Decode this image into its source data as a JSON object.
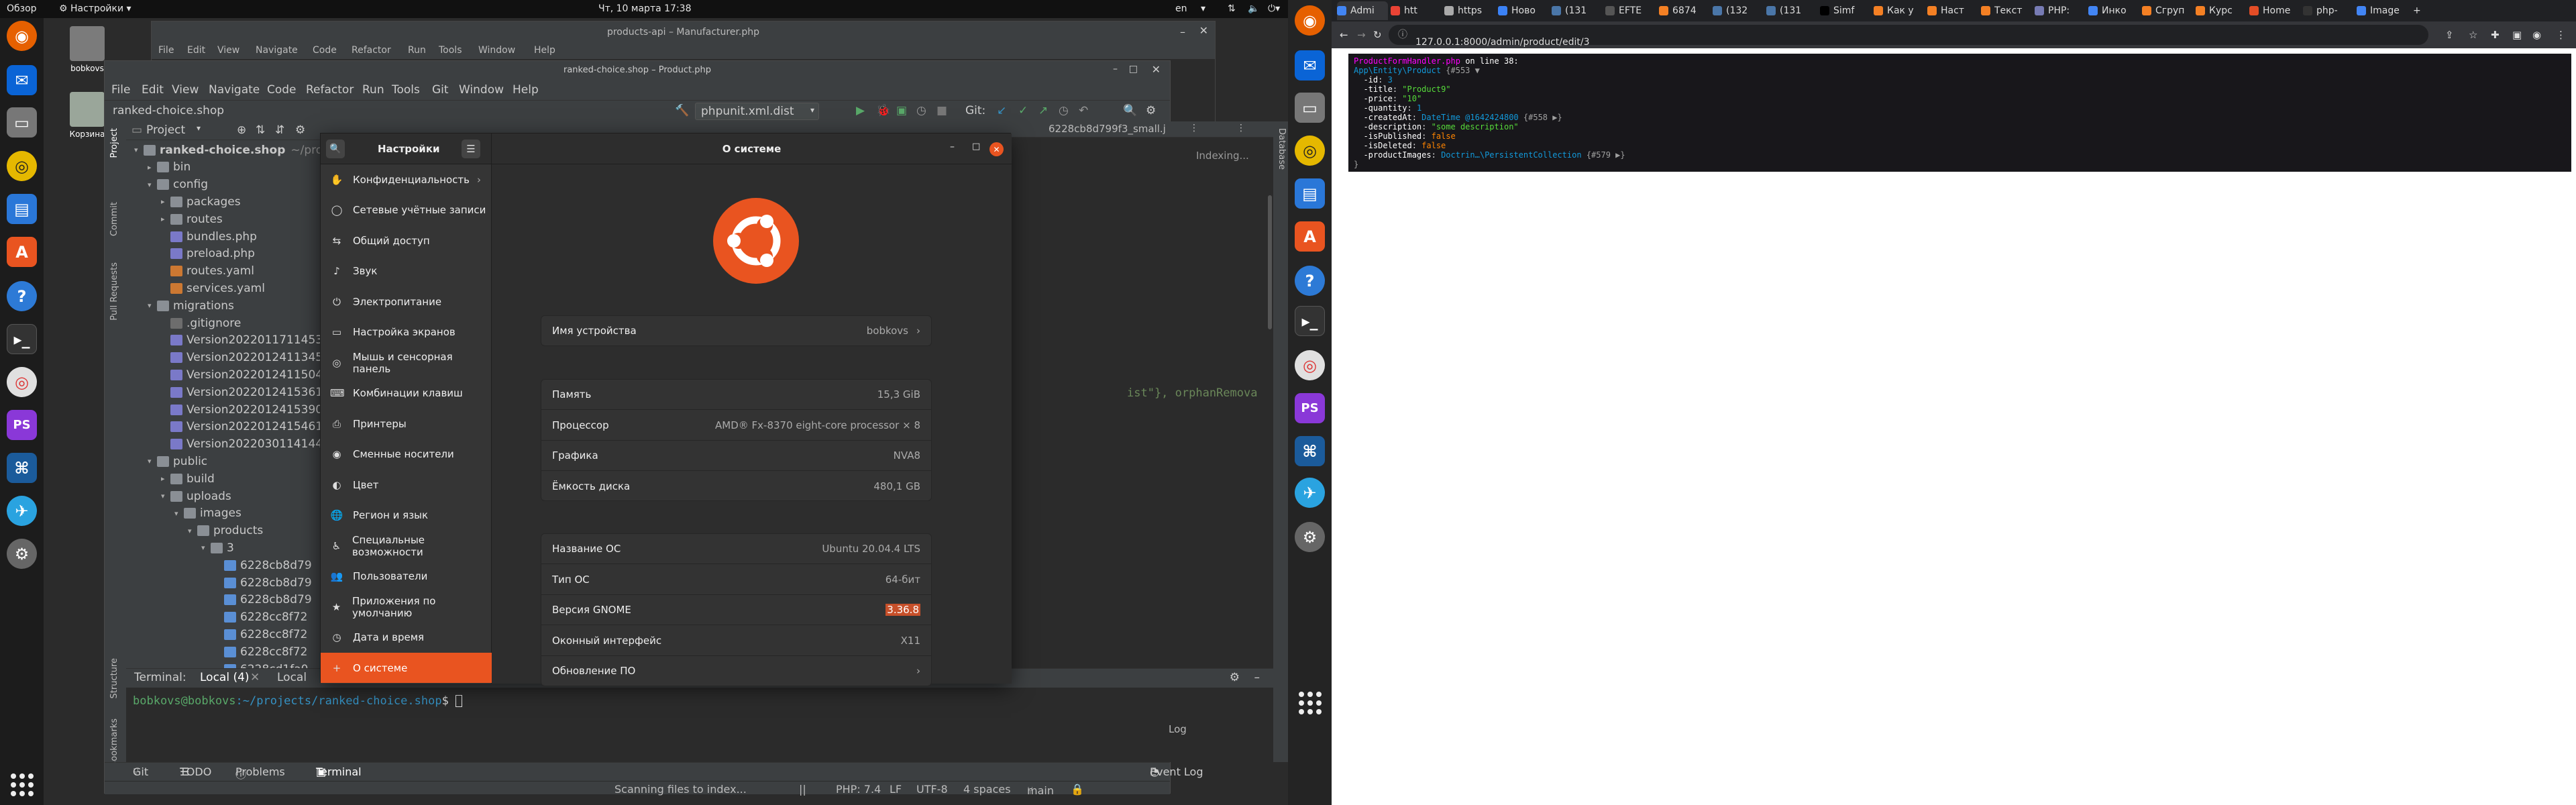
{
  "topbar": {
    "overview": "Обзор",
    "app_menu": "Настройки",
    "clock": "Чт, 10 марта  17:38",
    "lang": "en"
  },
  "desktop_icons": [
    {
      "label": "bobkovs",
      "name": "home-folder"
    },
    {
      "label": "Корзина",
      "name": "trash"
    }
  ],
  "ide_back": {
    "title": "products-api – Manufacturer.php",
    "menu": [
      "File",
      "Edit",
      "View",
      "Navigate",
      "Code",
      "Refactor",
      "Run",
      "Tools",
      "Window",
      "Help"
    ]
  },
  "ide": {
    "title": "ranked-choice.shop – Product.php",
    "menu": [
      "File",
      "Edit",
      "View",
      "Navigate",
      "Code",
      "Refactor",
      "Run",
      "Tools",
      "Git",
      "Window",
      "Help"
    ],
    "breadcrumb": "ranked-choice.shop",
    "run_config": "phpunit.xml.dist",
    "git_label": "Git:",
    "project_header": "Project",
    "indexing": "Indexing...",
    "editor_file_tab": "6228cb8d799f3_small.j",
    "code_fragment": "ist\"}, orphanRemova",
    "side_tabs": [
      "Project",
      "Commit",
      "Pull Requests",
      "Structure",
      "Bookmarks"
    ],
    "right_tabs": [
      "Database"
    ],
    "tree": [
      {
        "label": "ranked-choice.shop",
        "suffix": "~/proje",
        "level": 0,
        "kind": "folder",
        "open": true,
        "bold": true
      },
      {
        "label": "bin",
        "level": 1,
        "kind": "folder",
        "open": false
      },
      {
        "label": "config",
        "level": 1,
        "kind": "folder",
        "open": true
      },
      {
        "label": "packages",
        "level": 2,
        "kind": "folder",
        "open": false
      },
      {
        "label": "routes",
        "level": 2,
        "kind": "folder",
        "open": false
      },
      {
        "label": "bundles.php",
        "level": 2,
        "kind": "php"
      },
      {
        "label": "preload.php",
        "level": 2,
        "kind": "php"
      },
      {
        "label": "routes.yaml",
        "level": 2,
        "kind": "yml"
      },
      {
        "label": "services.yaml",
        "level": 2,
        "kind": "yml"
      },
      {
        "label": "migrations",
        "level": 1,
        "kind": "folder",
        "open": true
      },
      {
        "label": ".gitignore",
        "level": 2,
        "kind": "git"
      },
      {
        "label": "Version2022011711453",
        "level": 2,
        "kind": "php"
      },
      {
        "label": "Version2022012411345",
        "level": 2,
        "kind": "php"
      },
      {
        "label": "Version2022012411504",
        "level": 2,
        "kind": "php"
      },
      {
        "label": "Version2022012415361",
        "level": 2,
        "kind": "php"
      },
      {
        "label": "Version2022012415390",
        "level": 2,
        "kind": "php"
      },
      {
        "label": "Version2022012415461",
        "level": 2,
        "kind": "php"
      },
      {
        "label": "Version2022030114144",
        "level": 2,
        "kind": "php"
      },
      {
        "label": "public",
        "level": 1,
        "kind": "folder",
        "open": true
      },
      {
        "label": "build",
        "level": 2,
        "kind": "folder",
        "open": false
      },
      {
        "label": "uploads",
        "level": 2,
        "kind": "folder",
        "open": true
      },
      {
        "label": "images",
        "level": 3,
        "kind": "folder",
        "open": true
      },
      {
        "label": "products",
        "level": 4,
        "kind": "folder",
        "open": true
      },
      {
        "label": "3",
        "level": 5,
        "kind": "folder",
        "open": true
      },
      {
        "label": "6228cb8d79",
        "level": 6,
        "kind": "png"
      },
      {
        "label": "6228cb8d79",
        "level": 6,
        "kind": "png"
      },
      {
        "label": "6228cb8d79",
        "level": 6,
        "kind": "png"
      },
      {
        "label": "6228cc8f72",
        "level": 6,
        "kind": "png"
      },
      {
        "label": "6228cc8f72",
        "level": 6,
        "kind": "png"
      },
      {
        "label": "6228cc8f72",
        "level": 6,
        "kind": "png"
      },
      {
        "label": "6228cd1fa0",
        "level": 6,
        "kind": "png"
      }
    ],
    "terminal": {
      "label": "Terminal:",
      "tabs": [
        "Local (4)",
        "Local"
      ],
      "prompt_user": "bobkovs@bobkovs",
      "prompt_path": ":~/projects/ranked-choice.shop",
      "prompt_sign": "$"
    },
    "bottom_tabs": [
      "Git",
      "TODO",
      "Problems",
      "Terminal"
    ],
    "event_log": "Event Log",
    "status": {
      "scanning": "Scanning files to index...",
      "php": "PHP: 7.4",
      "lf": "LF",
      "encoding": "UTF-8",
      "indent": "4 spaces",
      "branch": "main"
    },
    "side_log": "Log"
  },
  "settings": {
    "sidebar_title": "Настройки",
    "page_title": "О системе",
    "items": [
      {
        "label": "Конфиденциальность",
        "icon": "hand-icon",
        "glyph": "✋",
        "chevron": true
      },
      {
        "label": "Сетевые учётные записи",
        "icon": "accounts-icon",
        "glyph": "◯"
      },
      {
        "label": "Общий доступ",
        "icon": "share-icon",
        "glyph": "⇆"
      },
      {
        "label": "Звук",
        "icon": "music-icon",
        "glyph": "♪"
      },
      {
        "label": "Электропитание",
        "icon": "power-icon",
        "glyph": "⏻"
      },
      {
        "label": "Настройка экранов",
        "icon": "display-icon",
        "glyph": "▭"
      },
      {
        "label": "Мышь и сенсорная панель",
        "icon": "mouse-icon",
        "glyph": "◎"
      },
      {
        "label": "Комбинации клавиш",
        "icon": "keyboard-icon",
        "glyph": "⌨"
      },
      {
        "label": "Принтеры",
        "icon": "printer-icon",
        "glyph": "⎙"
      },
      {
        "label": "Сменные носители",
        "icon": "disk-icon",
        "glyph": "◉"
      },
      {
        "label": "Цвет",
        "icon": "color-icon",
        "glyph": "◐"
      },
      {
        "label": "Регион и язык",
        "icon": "globe-icon",
        "glyph": "🌐"
      },
      {
        "label": "Специальные возможности",
        "icon": "accessibility-icon",
        "glyph": "♿"
      },
      {
        "label": "Пользователи",
        "icon": "users-icon",
        "glyph": "👥"
      },
      {
        "label": "Приложения по умолчанию",
        "icon": "star-icon",
        "glyph": "★"
      },
      {
        "label": "Дата и время",
        "icon": "clock-icon",
        "glyph": "◷"
      },
      {
        "label": "О системе",
        "icon": "plus-icon",
        "glyph": "+",
        "active": true
      }
    ],
    "device_name": {
      "label": "Имя устройства",
      "value": "bobkovs"
    },
    "hardware": [
      {
        "label": "Память",
        "value": "15,3 GiB"
      },
      {
        "label": "Процессор",
        "value": "AMD® Fx-8370 eight-core processor × 8"
      },
      {
        "label": "Графика",
        "value": "NVA8"
      },
      {
        "label": "Ёмкость диска",
        "value": "480,1 GB"
      }
    ],
    "os": [
      {
        "label": "Название ОС",
        "value": "Ubuntu 20.04.4 LTS"
      },
      {
        "label": "Тип ОС",
        "value": "64-бит"
      },
      {
        "label": "Версия GNOME",
        "value": "3.36.8",
        "highlight": true
      },
      {
        "label": "Оконный интерфейс",
        "value": "X11"
      },
      {
        "label": "Обновление ПО",
        "value": "",
        "chevron": true
      }
    ],
    "colors": {
      "accent": "#e95420",
      "highlight": "#c7502a"
    }
  },
  "browser": {
    "tabs": [
      {
        "label": "Admi",
        "color": "#4285f4"
      },
      {
        "label": "htt",
        "color": "#ea4335"
      },
      {
        "label": "https",
        "color": "#aaaaaa"
      },
      {
        "label": "Ново",
        "color": "#3b82f6"
      },
      {
        "label": "(131",
        "color": "#4a76a8"
      },
      {
        "label": "EFTE",
        "color": "#555555"
      },
      {
        "label": "6874",
        "color": "#f48024"
      },
      {
        "label": "(132",
        "color": "#4a76a8"
      },
      {
        "label": "(131",
        "color": "#4a76a8"
      },
      {
        "label": "Simf",
        "color": "#000000"
      },
      {
        "label": "Как у",
        "color": "#f48024"
      },
      {
        "label": "Наст",
        "color": "#f48024"
      },
      {
        "label": "Текст",
        "color": "#f48024"
      },
      {
        "label": "PHP:",
        "color": "#777bb4"
      },
      {
        "label": "Инко",
        "color": "#4285f4"
      },
      {
        "label": "Сгруп",
        "color": "#f48024"
      },
      {
        "label": "Курс",
        "color": "#f48024"
      },
      {
        "label": "Home",
        "color": "#e44d26"
      },
      {
        "label": "php-",
        "color": "#333333"
      },
      {
        "label": "Image",
        "color": "#4285f4"
      }
    ],
    "url": "127.0.0.1:8000/admin/product/edit/3",
    "dump": {
      "header_file": "ProductFormHandler.php",
      "header_line": "on line 38:",
      "class": "App\\Entity\\Product",
      "obj_id": "{#553 ▼",
      "fields": [
        {
          "key": "-id",
          "value": "3",
          "type": "num"
        },
        {
          "key": "-title",
          "value": "\"Product9\"",
          "type": "str"
        },
        {
          "key": "-price",
          "value": "\"10\"",
          "type": "str"
        },
        {
          "key": "-quantity",
          "value": "1",
          "type": "num"
        },
        {
          "key": "-createdAt",
          "value": "DateTime @1642424800",
          "extra": "{#558 ▶}",
          "type": "class"
        },
        {
          "key": "-description",
          "value": "\"some description\"",
          "type": "str"
        },
        {
          "key": "-isPublished",
          "value": "false",
          "type": "bool"
        },
        {
          "key": "-isDeleted",
          "value": "false",
          "type": "bool"
        },
        {
          "key": "-productImages",
          "value": "Doctrin…\\PersistentCollection",
          "extra": "{#579 ▶}",
          "type": "class"
        }
      ],
      "closing": "}"
    }
  }
}
